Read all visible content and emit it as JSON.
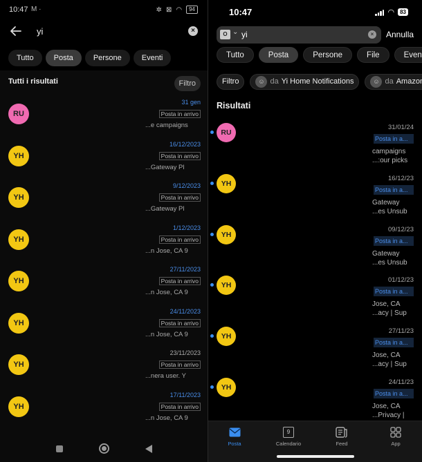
{
  "left": {
    "status": {
      "time": "10:47",
      "extra": "M ·",
      "battery": "94"
    },
    "search": {
      "query": "yi"
    },
    "tabs": [
      {
        "label": "Tutto",
        "active": false
      },
      {
        "label": "Posta",
        "active": true
      },
      {
        "label": "Persone",
        "active": false
      },
      {
        "label": "Eventi",
        "active": false
      }
    ],
    "results_header": "Tutti i risultati",
    "filter_label": "Filtro",
    "rows": [
      {
        "initials": "RU",
        "color": "#f06ab1",
        "date": "31 gen",
        "date_blue": true,
        "badge": "Posta in arrivo",
        "snippet": "e campaigns..."
      },
      {
        "initials": "YH",
        "color": "#f2c713",
        "date": "16/12/2023",
        "date_blue": true,
        "badge": "Posta in arrivo",
        "snippet": "Gateway Pl..."
      },
      {
        "initials": "YH",
        "color": "#f2c713",
        "date": "9/12/2023",
        "date_blue": true,
        "badge": "Posta in arrivo",
        "snippet": "Gateway Pl..."
      },
      {
        "initials": "YH",
        "color": "#f2c713",
        "date": "1/12/2023",
        "date_blue": true,
        "badge": "Posta in arrivo",
        "snippet": "n Jose, CA 9..."
      },
      {
        "initials": "YH",
        "color": "#f2c713",
        "date": "27/11/2023",
        "date_blue": true,
        "badge": "Posta in arrivo",
        "snippet": "n Jose, CA 9..."
      },
      {
        "initials": "YH",
        "color": "#f2c713",
        "date": "24/11/2023",
        "date_blue": true,
        "badge": "Posta in arrivo",
        "snippet": "n Jose, CA 9..."
      },
      {
        "initials": "YH",
        "color": "#f2c713",
        "date": "23/11/2023",
        "date_blue": false,
        "badge": "Posta in arrivo",
        "snippet": "nera user. Y..."
      },
      {
        "initials": "YH",
        "color": "#f2c713",
        "date": "17/11/2023",
        "date_blue": true,
        "badge": "Posta in arrivo",
        "snippet": "n Jose, CA 9..."
      }
    ]
  },
  "right": {
    "status": {
      "time": "10:47",
      "battery": "83"
    },
    "search": {
      "query": "yi",
      "cancel": "Annulla",
      "account_letter": "O"
    },
    "tabs": [
      {
        "label": "Tutto",
        "active": false
      },
      {
        "label": "Posta",
        "active": true
      },
      {
        "label": "Persone",
        "active": false
      },
      {
        "label": "File",
        "active": false
      },
      {
        "label": "Eventi",
        "active": false
      }
    ],
    "chips": {
      "filter": "Filtro",
      "chip1_prefix": "da",
      "chip1_name": "Yi Home Notifications",
      "chip2_prefix": "da",
      "chip2_name": "Amazon"
    },
    "results_header": "Risultati",
    "rows": [
      {
        "initials": "RU",
        "color": "#f06ab1",
        "date": "31/01/24",
        "badge": "Posta in a...",
        "line1": "campaigns",
        "line2": "our picks:..."
      },
      {
        "initials": "YH",
        "color": "#f2c713",
        "date": "16/12/23",
        "badge": "Posta in a...",
        "line1": "Gateway",
        "line2": "es Unsub..."
      },
      {
        "initials": "YH",
        "color": "#f2c713",
        "date": "09/12/23",
        "badge": "Posta in a...",
        "line1": "Gateway",
        "line2": "es Unsub..."
      },
      {
        "initials": "YH",
        "color": "#f2c713",
        "date": "01/12/23",
        "badge": "Posta in a...",
        "line1": "Jose, CA",
        "line2": "acy | Sup..."
      },
      {
        "initials": "YH",
        "color": "#f2c713",
        "date": "27/11/23",
        "badge": "Posta in a...",
        "line1": "Jose, CA",
        "line2": "acy | Sup..."
      },
      {
        "initials": "YH",
        "color": "#f2c713",
        "date": "24/11/23",
        "badge": "Posta in a...",
        "line1": "Jose, CA",
        "line2": "| Privacy..."
      }
    ],
    "tabbar": {
      "posta": "Posta",
      "calendario": "Calendario",
      "calendar_day": "9",
      "feed": "Feed",
      "app": "App"
    }
  }
}
